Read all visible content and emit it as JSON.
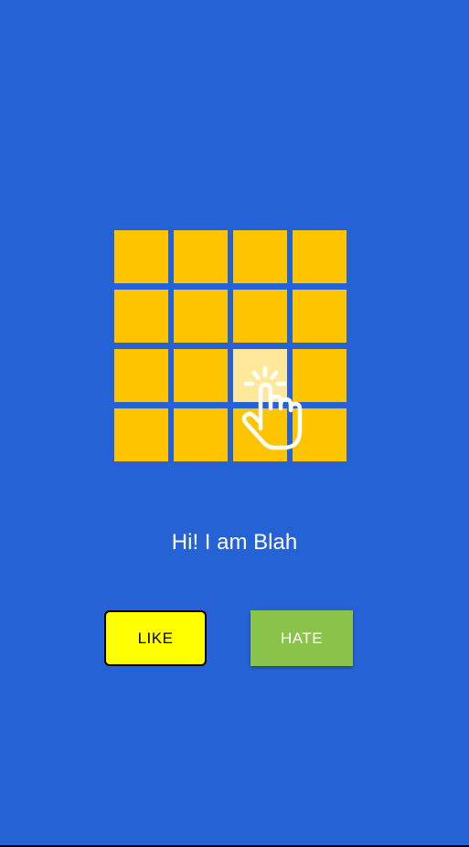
{
  "colors": {
    "background": "#2562d6",
    "tile": "#ffc400",
    "tile_highlight": "#ffe89c",
    "like_button": "#ffff00",
    "hate_button": "#8bc34a"
  },
  "grid": {
    "rows": 4,
    "columns": 4,
    "highlighted": {
      "row": 3,
      "column": 3
    }
  },
  "hint_icon": "tap-hand-icon",
  "greeting": "Hi! I am Blah",
  "buttons": {
    "like_label": "LIKE",
    "hate_label": "HATE"
  }
}
